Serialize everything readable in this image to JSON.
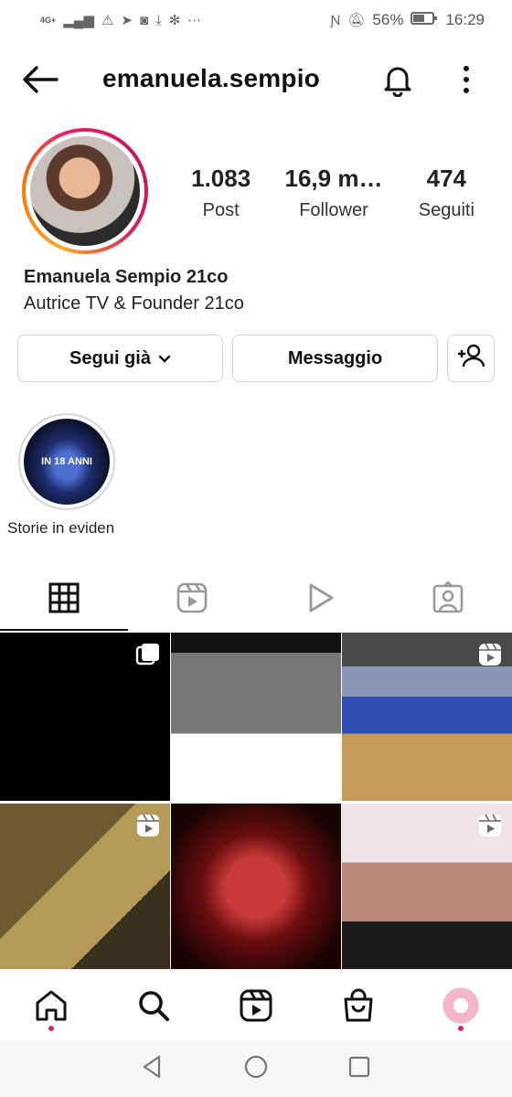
{
  "status_bar": {
    "network": "4G+",
    "battery": "56%",
    "time": "16:29",
    "left_icons": [
      "signal-icon",
      "warning-icon",
      "telegram-icon",
      "instagram-icon",
      "download-icon",
      "asterisk-icon",
      "more-dots-icon"
    ],
    "right_icons": [
      "nfc-icon",
      "mute-icon",
      "battery-icon"
    ]
  },
  "header": {
    "username": "emanuela.sempio"
  },
  "profile": {
    "stats": [
      {
        "value": "1.083",
        "label": "Post"
      },
      {
        "value": "16,9 m…",
        "label": "Follower"
      },
      {
        "value": "474",
        "label": "Seguiti"
      }
    ],
    "name": "Emanuela Sempio 21co",
    "bio": "Autrice TV & Founder 21co"
  },
  "buttons": {
    "follow": "Segui già",
    "message": "Messaggio"
  },
  "highlights": [
    {
      "label": "Storie in eviden",
      "cover_text": "IN 18 ANNI"
    }
  ],
  "tabs": [
    "grid-icon",
    "reels-icon",
    "video-icon",
    "tagged-icon"
  ],
  "grid": {
    "posts": [
      {
        "badge": "carousel-icon"
      },
      {
        "badge": ""
      },
      {
        "badge": "reels-icon"
      },
      {
        "badge": "reels-icon"
      },
      {
        "badge": ""
      },
      {
        "badge": "reels-icon"
      }
    ]
  },
  "colors": {
    "accent": "#e0245e",
    "ring_start": "#f9a825",
    "ring_end": "#c2185b"
  }
}
